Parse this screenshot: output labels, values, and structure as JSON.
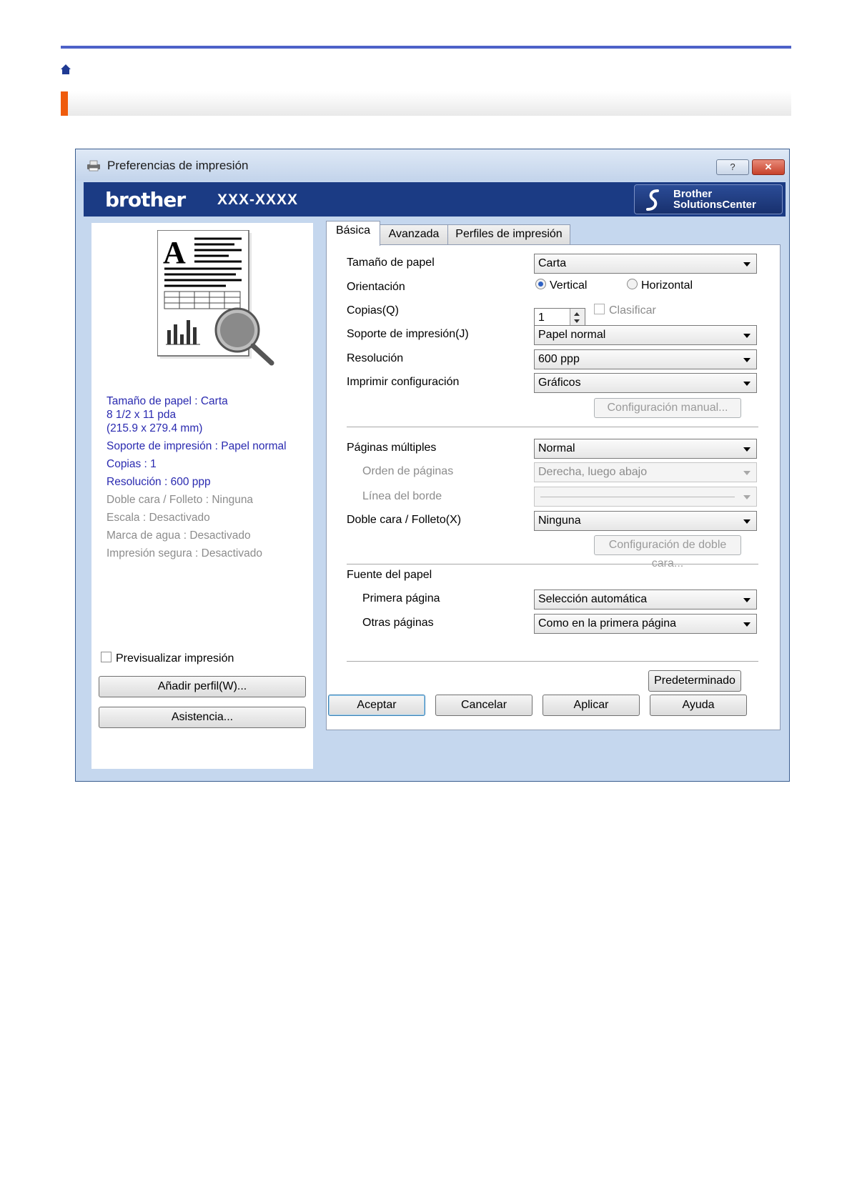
{
  "page": {
    "colors": {
      "rule": "#4d62c8",
      "accent": "#ef5b0c",
      "brand_bar": "#1b3b84",
      "summary_active": "#2a2ab0",
      "summary_dim": "#8c8c8c"
    }
  },
  "window": {
    "title": "Preferencias de impresión",
    "help_label": "?",
    "close_label": "✕"
  },
  "brand": {
    "logo": "brother",
    "model": "XXX-XXXX",
    "solutions_label": "Brother\nSolutionsCenter"
  },
  "summary": {
    "paper_size": "Tamaño de papel : Carta",
    "paper_dims_1": "8 1/2 x 11 pda",
    "paper_dims_2": "(215.9 x 279.4 mm)",
    "media": "Soporte de impresión : Papel normal",
    "copies": "Copias : 1",
    "resolution": "Resolución : 600 ppp",
    "duplex": "Doble cara / Folleto : Ninguna",
    "scale": "Escala : Desactivado",
    "watermark": "Marca de agua : Desactivado",
    "secure": "Impresión segura : Desactivado"
  },
  "left": {
    "preview_checkbox": "Previsualizar impresión",
    "add_profile": "Añadir perfil(W)...",
    "support": "Asistencia..."
  },
  "tabs": [
    "Básica",
    "Avanzada",
    "Perfiles de impresión"
  ],
  "form": {
    "paper_size_label": "Tamaño de papel",
    "paper_size_value": "Carta",
    "orientation_label": "Orientación",
    "orientation_vertical": "Vertical",
    "orientation_horizontal": "Horizontal",
    "copies_label": "Copias(Q)",
    "copies_value": "1",
    "collate_label": "Clasificar",
    "media_label": "Soporte de impresión(J)",
    "media_value": "Papel normal",
    "resolution_label": "Resolución",
    "resolution_value": "600 ppp",
    "print_settings_label": "Imprimir configuración",
    "print_settings_value": "Gráficos",
    "manual_settings_button": "Configuración manual...",
    "multiple_pages_label": "Páginas múltiples",
    "multiple_pages_value": "Normal",
    "page_order_label": "Orden de páginas",
    "page_order_value": "Derecha, luego abajo",
    "border_line_label": "Línea del borde",
    "duplex_label": "Doble cara / Folleto(X)",
    "duplex_value": "Ninguna",
    "duplex_settings_button": "Configuración de doble cara...",
    "paper_source_label": "Fuente del papel",
    "first_page_label": "Primera página",
    "first_page_value": "Selección automática",
    "other_pages_label": "Otras páginas",
    "other_pages_value": "Como en la primera página",
    "default_button": "Predeterminado"
  },
  "footer": {
    "ok": "Aceptar",
    "cancel": "Cancelar",
    "apply": "Aplicar",
    "help": "Ayuda"
  }
}
